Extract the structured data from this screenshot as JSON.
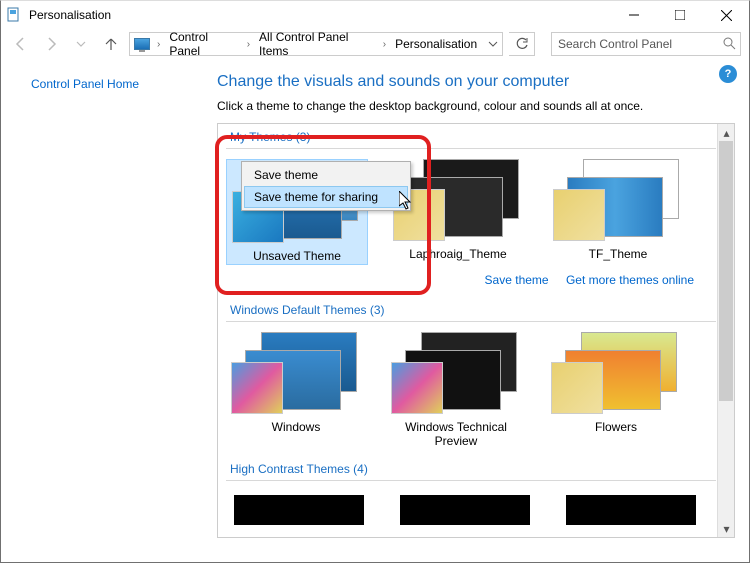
{
  "window": {
    "title": "Personalisation"
  },
  "breadcrumbs": {
    "a": "Control Panel",
    "b": "All Control Panel Items",
    "c": "Personalisation"
  },
  "search": {
    "placeholder": "Search Control Panel"
  },
  "sidebar": {
    "home": "Control Panel Home"
  },
  "main": {
    "heading": "Change the visuals and sounds on your computer",
    "sub": "Click a theme to change the desktop background, colour and sounds all at once."
  },
  "groups": {
    "my": "My Themes (3)",
    "default": "Windows Default Themes (3)",
    "hc": "High Contrast Themes (4)"
  },
  "themes": {
    "my": [
      {
        "label": "Unsaved Theme"
      },
      {
        "label": "Laphroaig_Theme"
      },
      {
        "label": "TF_Theme"
      }
    ],
    "default": [
      {
        "label": "Windows"
      },
      {
        "label": "Windows Technical Preview"
      },
      {
        "label": "Flowers"
      }
    ]
  },
  "links": {
    "save": "Save theme",
    "getmore": "Get more themes online"
  },
  "contextmenu": {
    "item1": "Save theme",
    "item2": "Save theme for sharing"
  },
  "help": "?"
}
